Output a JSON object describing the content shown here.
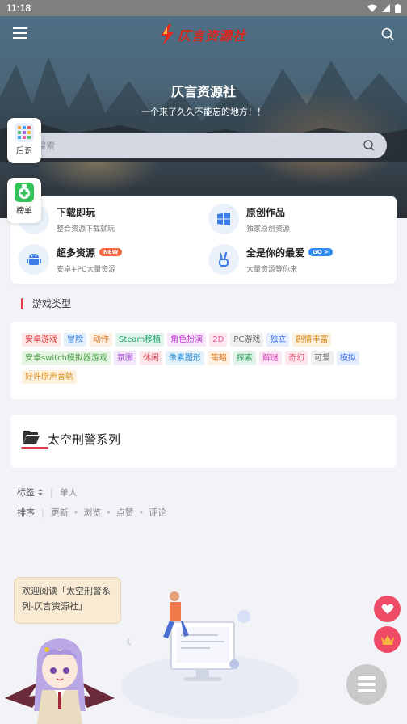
{
  "status": {
    "time": "11:18"
  },
  "header": {
    "logo_text": "仄言资源社",
    "site_title": "仄言资源社",
    "site_subtitle": "一个来了久久不能忘的地方！！"
  },
  "search": {
    "placeholder": "搜索"
  },
  "side_buttons": [
    {
      "label": "后识",
      "icon": "apps-grid-icon"
    },
    {
      "label": "榜单",
      "icon": "plus-badge-icon"
    }
  ],
  "features": [
    {
      "title": "下载即玩",
      "desc": "整合资源下载就玩",
      "icon": "download-icon"
    },
    {
      "title": "原创作品",
      "desc": "独家原创资源",
      "icon": "windows-icon"
    },
    {
      "title": "超多资源",
      "desc": "安卓+PC大量资源",
      "badge": "NEW",
      "badge_color": "#f56a45",
      "icon": "android-icon"
    },
    {
      "title": "全是你的最爱",
      "desc": "大量资源等你来",
      "badge": "GO >",
      "badge_color": "#2f8cf0",
      "icon": "peace-hand-icon"
    }
  ],
  "section_title": "游戏类型",
  "tags": [
    {
      "label": "安卓游戏",
      "color": "#e23b3b",
      "bg": "#fde8e8"
    },
    {
      "label": "冒险",
      "color": "#2f7ce0",
      "bg": "#e5effc"
    },
    {
      "label": "动作",
      "color": "#e07a1c",
      "bg": "#fdf0e2"
    },
    {
      "label": "Steam移植",
      "color": "#1ba36a",
      "bg": "#e2f5ec"
    },
    {
      "label": "角色扮演",
      "color": "#c23ed0",
      "bg": "#f8e6fa"
    },
    {
      "label": "2D",
      "color": "#e85a9b",
      "bg": "#fde7f1"
    },
    {
      "label": "PC游戏",
      "color": "#666666",
      "bg": "#efefef"
    },
    {
      "label": "独立",
      "color": "#3a6ee8",
      "bg": "#e6edfd"
    },
    {
      "label": "剧情丰富",
      "color": "#d98a1a",
      "bg": "#fcf1de"
    },
    {
      "label": "安卓switch模拟器游戏",
      "color": "#4aa046",
      "bg": "#e6f4e4"
    },
    {
      "label": "氛围",
      "color": "#a44ad0",
      "bg": "#f2e6fa"
    },
    {
      "label": "休闲",
      "color": "#d8344a",
      "bg": "#fce5e8"
    },
    {
      "label": "像素图形",
      "color": "#2a8fd6",
      "bg": "#e3f1fb"
    },
    {
      "label": "策略",
      "color": "#e07a1c",
      "bg": "#fdf0e2"
    },
    {
      "label": "探索",
      "color": "#2a9a5a",
      "bg": "#e2f4e9"
    },
    {
      "label": "解谜",
      "color": "#d848b8",
      "bg": "#fbe7f6"
    },
    {
      "label": "奇幻",
      "color": "#e85a7a",
      "bg": "#fde7ec"
    },
    {
      "label": "可爱",
      "color": "#666666",
      "bg": "#efefef"
    },
    {
      "label": "模拟",
      "color": "#3a6ee8",
      "bg": "#e6edfd"
    },
    {
      "label": "好评原声音轨",
      "color": "#d98a1a",
      "bg": "#fcf1de"
    }
  ],
  "series": {
    "title": "太空刑警系列"
  },
  "filters": {
    "tag_label": "标签",
    "tag_value": "单人",
    "sort_label": "排序",
    "sort_options": [
      "更新",
      "浏览",
      "点赞",
      "评论"
    ]
  },
  "bubble_text": "欢迎阅读「太空刑警系列-仄言资源社」",
  "accent_color": "#e8364f"
}
